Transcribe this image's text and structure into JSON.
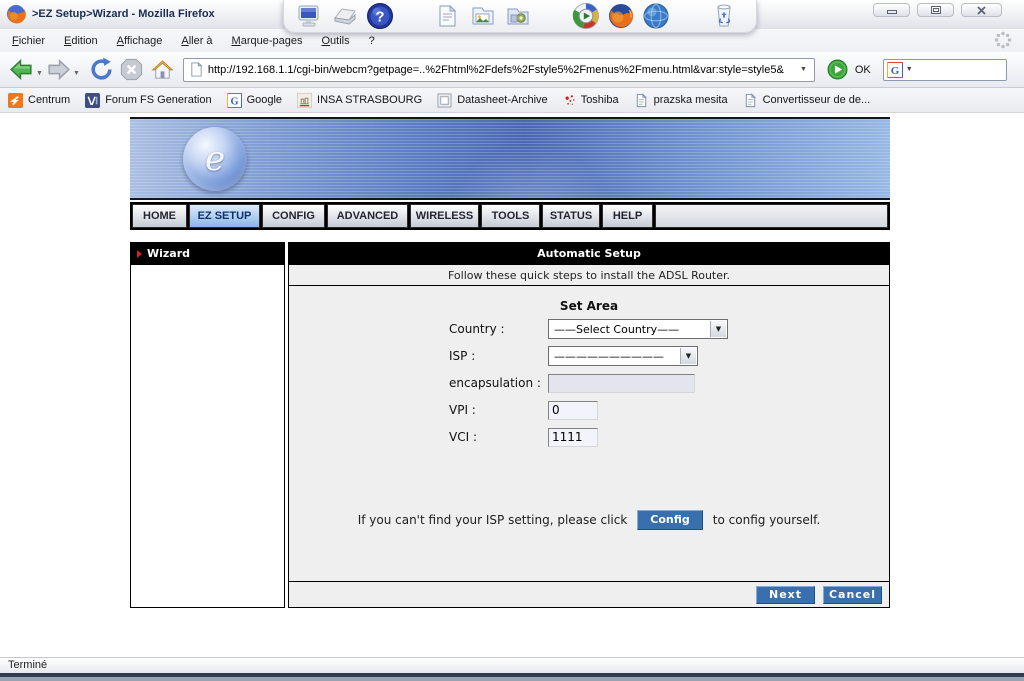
{
  "window": {
    "title": ">EZ Setup>Wizard - Mozilla Firefox",
    "status": "Terminé"
  },
  "menu": {
    "items": [
      "Fichier",
      "Edition",
      "Affichage",
      "Aller à",
      "Marque-pages",
      "Outils",
      "?"
    ]
  },
  "toolbar": {
    "url": "http://192.168.1.1/cgi-bin/webcm?getpage=..%2Fhtml%2Fdefs%2Fstyle5%2Fmenus%2Fmenu.html&var:style=style5&",
    "go_label": "OK",
    "search_value": ""
  },
  "bookmarks": {
    "items": [
      "Centrum",
      "Forum FS Generation",
      "Google",
      "INSA STRASBOURG",
      "Datasheet-Archive",
      "Toshiba",
      "prazska mesita",
      "Convertisseur de de..."
    ]
  },
  "page": {
    "nav_tabs": [
      "HOME",
      "EZ SETUP",
      "CONFIG",
      "ADVANCED",
      "WIRELESS",
      "TOOLS",
      "STATUS",
      "HELP"
    ],
    "active_tab": "EZ SETUP",
    "sidebar_item": "Wizard",
    "section_title": "Automatic Setup",
    "instruction": "Follow these quick steps to install the ADSL Router.",
    "form": {
      "group_title": "Set Area",
      "country_label": "Country :",
      "country_value": "——Select Country——",
      "isp_label": "ISP :",
      "isp_value": "——————————",
      "encapsulation_label": "encapsulation :",
      "encapsulation_value": "",
      "vpi_label": "VPI :",
      "vpi_value": "0",
      "vci_label": "VCI :",
      "vci_value": "1111"
    },
    "hint": {
      "before": "If you can't find your ISP setting, please click",
      "button": "Config",
      "after": "to config yourself."
    },
    "footer": {
      "next": "Next",
      "cancel": "Cancel"
    }
  },
  "colors": {
    "accent_blue": "#3a6fae",
    "active_tab_blue": "#8cb5e8",
    "banner_blue": "#4a68b2",
    "header_black": "#000000"
  }
}
